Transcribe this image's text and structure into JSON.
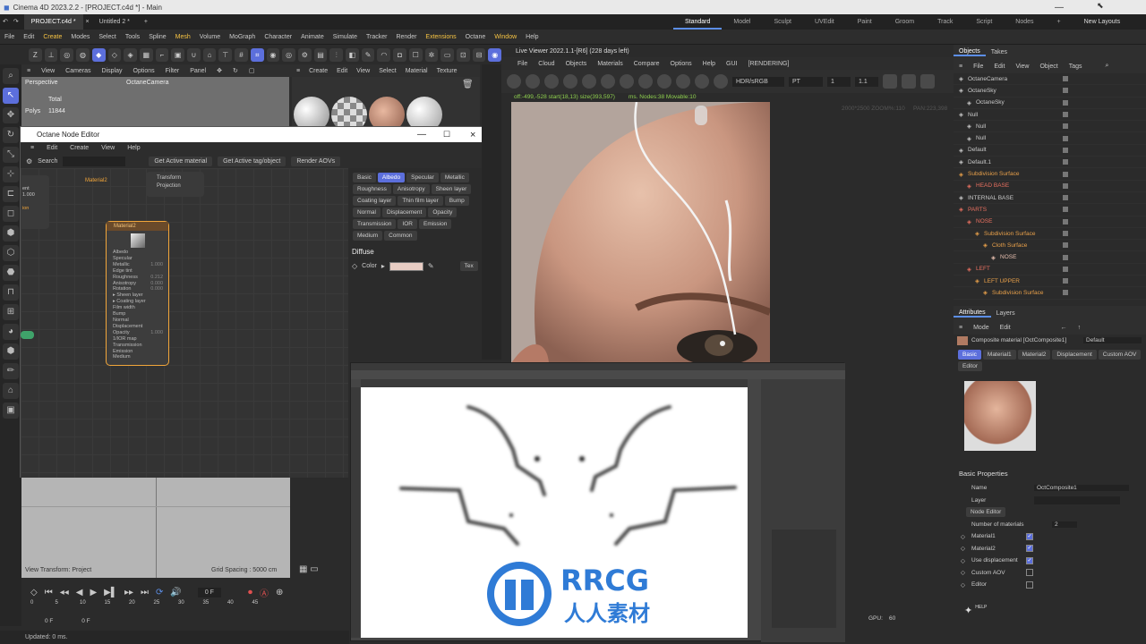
{
  "window": {
    "title": "Cinema 4D 2023.2.2 - [PROJECT.c4d *] - Main"
  },
  "tabs": [
    {
      "label": "PROJECT.c4d *"
    },
    {
      "label": "Untitled 2 *"
    }
  ],
  "layouts": [
    "Standard",
    "Model",
    "Sculpt",
    "UVEdit",
    "Paint",
    "Groom",
    "Track",
    "Script",
    "Nodes"
  ],
  "new_layouts": "New Layouts",
  "menu": [
    "File",
    "Edit",
    "Create",
    "Modes",
    "Select",
    "Tools",
    "Spline",
    "Mesh",
    "Volume",
    "MoGraph",
    "Character",
    "Animate",
    "Simulate",
    "Tracker",
    "Render",
    "Extensions",
    "Octane",
    "Window",
    "Help"
  ],
  "viewport": {
    "menu": [
      "View",
      "Cameras",
      "Display",
      "Options",
      "Filter",
      "Panel"
    ],
    "label": "Perspective",
    "camera": "OctaneCamera",
    "stats_total": "Total",
    "stats_polys_label": "Polys",
    "stats_polys": "11844",
    "transform": "View Transform: Project",
    "grid": "Grid Spacing : 5000 cm"
  },
  "material_manager": {
    "menu": [
      "Create",
      "Edit",
      "View",
      "Select",
      "Material",
      "Texture"
    ]
  },
  "node_editor": {
    "title": "Octane Node Editor",
    "menu": [
      "Edit",
      "Create",
      "View",
      "Help"
    ],
    "search": "Search",
    "buttons": [
      "Get Active material",
      "Get Active tag/object",
      "Render AOVs"
    ],
    "upper_node": {
      "label": "Material2",
      "ports": [
        "Transform",
        "Projection"
      ]
    },
    "left_node": {
      "labels": [
        "ent",
        "1.000",
        "ion"
      ]
    },
    "node": {
      "title": "Material2",
      "params": [
        {
          "n": "Albedo",
          "v": ""
        },
        {
          "n": "Specular",
          "v": ""
        },
        {
          "n": "Metallic",
          "v": "1.000"
        },
        {
          "n": "Edge tint",
          "v": ""
        },
        {
          "n": "Roughness",
          "v": "0.212"
        },
        {
          "n": "Anisotropy",
          "v": "0.000"
        },
        {
          "n": "Rotation",
          "v": "0.000"
        },
        {
          "n": "▸ Sheen layer",
          "v": ""
        },
        {
          "n": "▸ Coating layer",
          "v": ""
        },
        {
          "n": "Film width",
          "v": ""
        },
        {
          "n": "Bump",
          "v": ""
        },
        {
          "n": "Normal",
          "v": ""
        },
        {
          "n": "Displacement",
          "v": ""
        },
        {
          "n": "Opacity",
          "v": "1.000"
        },
        {
          "n": "1/IOR map",
          "v": ""
        },
        {
          "n": "Transmission",
          "v": ""
        },
        {
          "n": "Emission",
          "v": ""
        },
        {
          "n": "Medium",
          "v": ""
        }
      ]
    },
    "prop_tabs": [
      "Basic",
      "Albedo",
      "Specular",
      "Metallic",
      "Roughness",
      "Anisotropy",
      "Sheen layer",
      "Coating layer",
      "Thin film layer",
      "Bump",
      "Normal",
      "Displacement",
      "Opacity",
      "Transmission",
      "IOR",
      "Emission",
      "Medium",
      "Common"
    ],
    "selected_tab": "Albedo",
    "section": "Diffuse",
    "color_label": "Color",
    "tex_button": "Tex",
    "diffuse_color": "#e8cdc4"
  },
  "live_viewer": {
    "title": "Live Viewer 2022.1.1-[R6] (228 days left)",
    "menu": [
      "File",
      "Cloud",
      "Objects",
      "Materials",
      "Compare",
      "Options",
      "Help",
      "GUI",
      "[RENDERING]"
    ],
    "colorspace": "HDR/sRGB",
    "mode": "PT",
    "val1": "1",
    "val2": "1.1",
    "overlay_text": "off:-499,-528 start(18,13) size(393,597)",
    "overlay_text2": "ms. Nodes:38 Movable:10",
    "info_right": "2000*2500 ZOOM%:110",
    "info_right2": "PAN:223,398"
  },
  "objects_panel": {
    "tabs": [
      "Objects",
      "Takes"
    ],
    "menu": [
      "File",
      "Edit",
      "View",
      "Object",
      "Tags"
    ],
    "items": [
      {
        "name": "OctaneCamera",
        "indent": 0,
        "color": "#c9c9c9"
      },
      {
        "name": "OctaneSky",
        "indent": 0,
        "color": "#c9c9c9"
      },
      {
        "name": "OctaneSky",
        "indent": 1,
        "color": "#c9c9c9"
      },
      {
        "name": "Null",
        "indent": 0,
        "color": "#c9c9c9"
      },
      {
        "name": "Null",
        "indent": 1,
        "color": "#c9c9c9"
      },
      {
        "name": "Null",
        "indent": 1,
        "color": "#c9c9c9"
      },
      {
        "name": "Default",
        "indent": 0,
        "color": "#c9c9c9"
      },
      {
        "name": "Default.1",
        "indent": 0,
        "color": "#c9c9c9"
      },
      {
        "name": "Subdivision Surface",
        "indent": 0,
        "color": "#e8a04a"
      },
      {
        "name": "HEAD BASE",
        "indent": 1,
        "color": "#e87060"
      },
      {
        "name": "INTERNAL BASE",
        "indent": 0,
        "color": "#c9c9c9"
      },
      {
        "name": "PARTS",
        "indent": 0,
        "color": "#e87060"
      },
      {
        "name": "NOSE",
        "indent": 1,
        "color": "#e87060"
      },
      {
        "name": "Subdivision Surface",
        "indent": 2,
        "color": "#e8a04a"
      },
      {
        "name": "Cloth Surface",
        "indent": 3,
        "color": "#e8a04a"
      },
      {
        "name": "NOSE",
        "indent": 4,
        "color": "#e8c0b0"
      },
      {
        "name": "LEFT",
        "indent": 1,
        "color": "#e87060"
      },
      {
        "name": "LEFT UPPER",
        "indent": 2,
        "color": "#e8a04a"
      },
      {
        "name": "Subdivision Surface",
        "indent": 3,
        "color": "#e8a04a"
      }
    ]
  },
  "attributes": {
    "tabs": [
      "Attributes",
      "Layers"
    ],
    "menu": [
      "Mode",
      "Edit"
    ],
    "title": "Composite material [OctComposite1]",
    "preset": "Default",
    "subtabs": [
      "Basic",
      "Material1",
      "Material2",
      "Displacement",
      "Custom AOV",
      "Editor"
    ],
    "section": "Basic Properties",
    "name_label": "Name",
    "name_value": "OctComposite1",
    "layer_label": "Layer",
    "node_editor_btn": "Node Editor",
    "num_label": "Number of materials",
    "num_value": "2",
    "checks": [
      {
        "label": "Material1",
        "checked": true
      },
      {
        "label": "Material2",
        "checked": true
      },
      {
        "label": "Use displacement",
        "checked": true
      },
      {
        "label": "Custom AOV",
        "checked": false
      },
      {
        "label": "Editor",
        "checked": false
      }
    ],
    "help": "HELP"
  },
  "timeline": {
    "frame": "0 F",
    "start": "0 F",
    "end": "0 F",
    "ticks": [
      "0",
      "5",
      "10",
      "15",
      "20",
      "25",
      "30",
      "35",
      "40",
      "45"
    ]
  },
  "status": {
    "text": "Updated: 0 ms."
  },
  "photoshop_gpu": "GPU:",
  "photoshop_gpu_val": "60",
  "watermark": {
    "title": "RRCG",
    "subtitle": "人人素材"
  }
}
